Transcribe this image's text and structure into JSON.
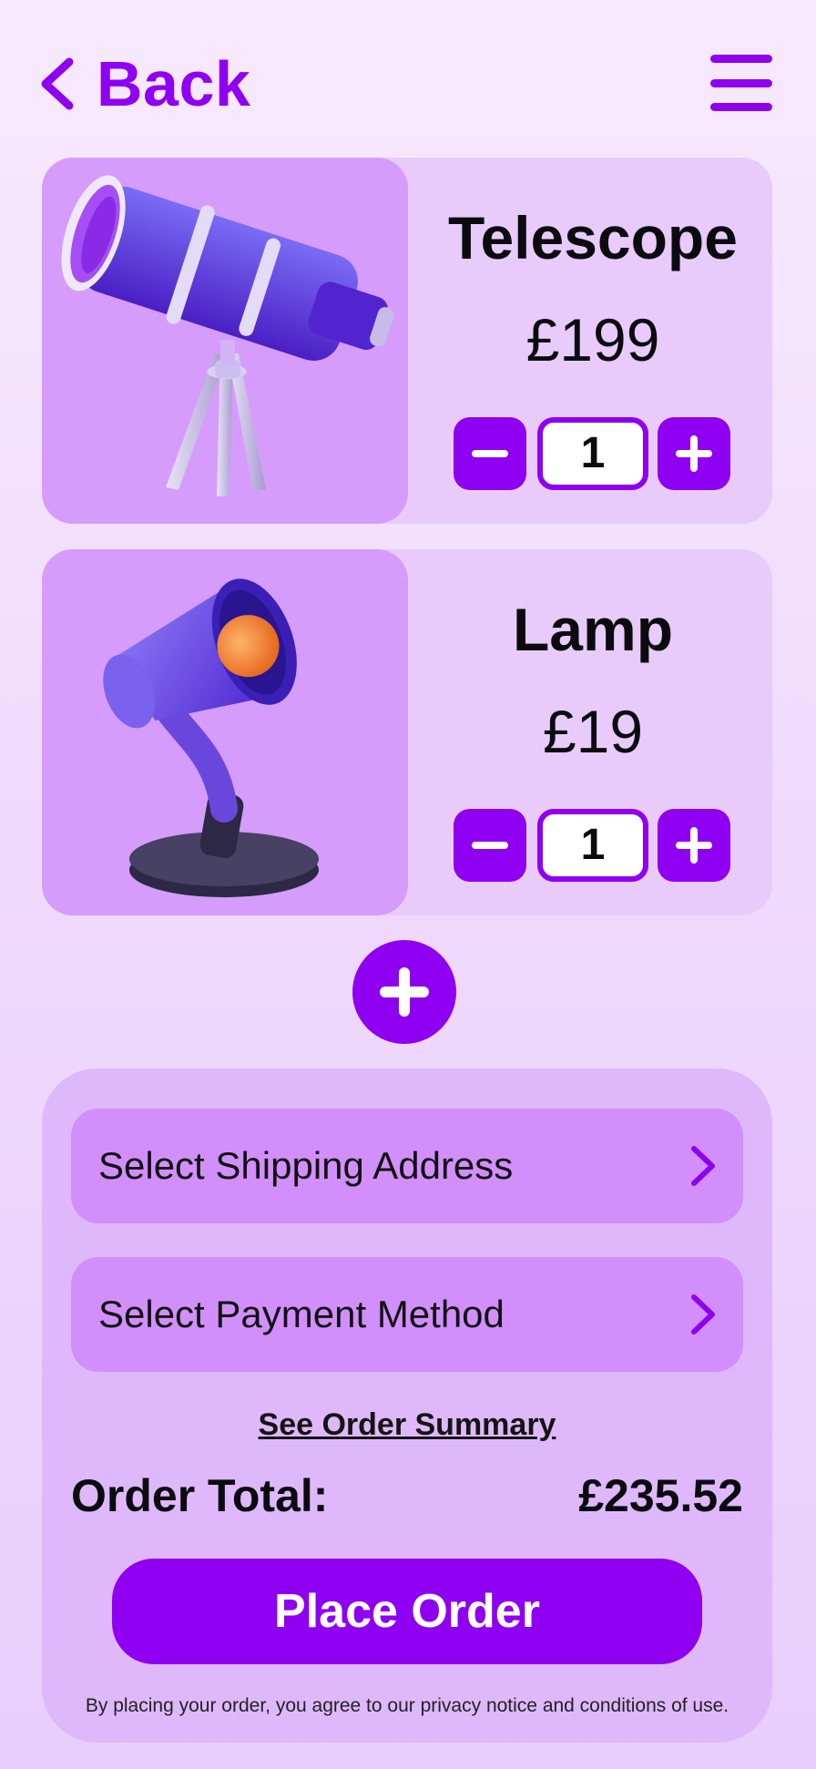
{
  "header": {
    "back_label": "Back",
    "menu_icon": "hamburger-menu-icon"
  },
  "products": [
    {
      "name": "Telescope",
      "price": "£199",
      "quantity": "1",
      "image": "telescope-illustration"
    },
    {
      "name": "Lamp",
      "price": "£19",
      "quantity": "1",
      "image": "desk-lamp-illustration"
    }
  ],
  "checkout": {
    "shipping_label": "Select Shipping Address",
    "payment_label": "Select Payment Method",
    "summary_link": "See Order Summary",
    "total_label": "Order Total:",
    "total_value": "£235.52",
    "place_order_label": "Place Order",
    "disclaimer": "By placing your order, you agree to our privacy notice and conditions of use."
  },
  "colors": {
    "accent": "#8f00f2",
    "card_bg": "#e8cbfb",
    "image_bg": "#d69cfc",
    "panel_bg": "#dfb8fb",
    "row_bg": "#d28ffc"
  }
}
